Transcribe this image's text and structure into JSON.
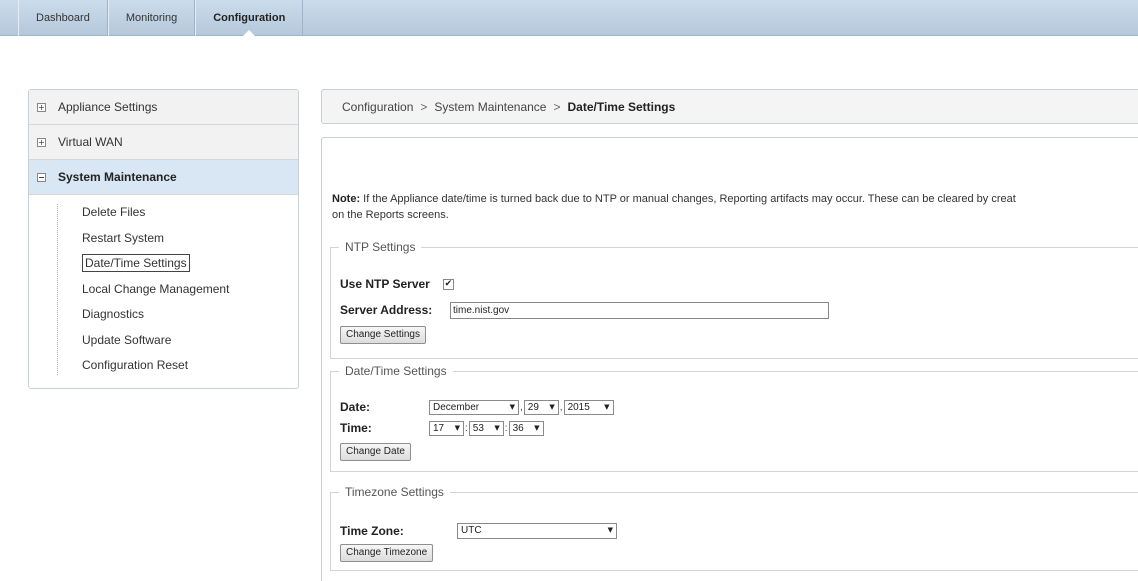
{
  "nav": {
    "tabs": [
      "Dashboard",
      "Monitoring",
      "Configuration"
    ],
    "active": "Configuration"
  },
  "sidebar": {
    "appliance_settings": "Appliance Settings",
    "virtual_wan": "Virtual WAN",
    "system_maintenance": "System Maintenance",
    "items": [
      "Delete Files",
      "Restart System",
      "Date/Time Settings",
      "Local Change Management",
      "Diagnostics",
      "Update Software",
      "Configuration Reset"
    ],
    "selected": "Date/Time Settings",
    "collapsed_symbol": "+",
    "expanded_symbol": "−"
  },
  "breadcrumb": {
    "items": [
      "Configuration",
      "System Maintenance",
      "Date/Time Settings"
    ],
    "separator": ">"
  },
  "note": {
    "label": "Note:",
    "line1": " If the Appliance date/time is turned back due to NTP or manual changes, Reporting artifacts may occur. These can be cleared by creat",
    "line2": "on the Reports screens."
  },
  "ntp": {
    "legend": "NTP Settings",
    "use_label": "Use NTP Server",
    "use_checked": true,
    "check_mark": "✔",
    "server_label": "Server Address:",
    "server_value": "time.nist.gov",
    "button": "Change Settings"
  },
  "datetime": {
    "legend": "Date/Time Settings",
    "date_label": "Date:",
    "month": "December",
    "day": "29",
    "year": "2015",
    "time_label": "Time:",
    "hour": "17",
    "minute": "53",
    "second": "36",
    "button": "Change Date"
  },
  "timezone": {
    "legend": "Timezone Settings",
    "label": "Time Zone:",
    "value": "UTC",
    "button": "Change Timezone"
  },
  "icons": {
    "dropdown": "▼"
  }
}
